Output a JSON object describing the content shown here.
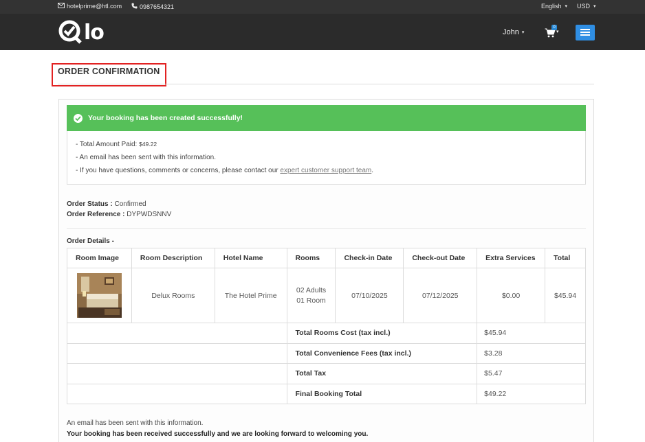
{
  "topbar": {
    "email": "hotelprime@htl.com",
    "phone": "0987654321",
    "language": "English",
    "currency": "USD"
  },
  "navbar": {
    "logo_text": "lo",
    "user_name": "John",
    "cart_count": "0"
  },
  "page": {
    "heading": "ORDER CONFIRMATION"
  },
  "alert": {
    "message": "Your booking has been created successfully!",
    "total_paid_label": "- Total Amount Paid:",
    "total_paid_value": "$49.22",
    "email_line": "- An email has been sent with this information.",
    "support_prefix": "- If you have questions, comments or concerns, please contact our",
    "support_link": "expert customer support team",
    "support_suffix": "."
  },
  "order": {
    "status_label": "Order Status :",
    "status_value": "Confirmed",
    "reference_label": "Order Reference :",
    "reference_value": "DYPWDSNNV",
    "details_label": "Order Details -"
  },
  "table": {
    "headers": [
      "Room Image",
      "Room Description",
      "Hotel Name",
      "Rooms",
      "Check-in Date",
      "Check-out Date",
      "Extra Services",
      "Total"
    ],
    "row": {
      "description": "Delux Rooms",
      "hotel": "The Hotel Prime",
      "adults": "02 Adults",
      "rooms": "01 Room",
      "checkin": "07/10/2025",
      "checkout": "07/12/2025",
      "extra": "$0.00",
      "total": "$45.94"
    },
    "summary": [
      {
        "label": "Total Rooms Cost (tax incl.)",
        "value": "$45.94"
      },
      {
        "label": "Total Convenience Fees (tax incl.)",
        "value": "$3.28"
      },
      {
        "label": "Total Tax",
        "value": "$5.47"
      },
      {
        "label": "Final Booking Total",
        "value": "$49.22"
      }
    ]
  },
  "footer": {
    "email_note": "An email has been sent with this information.",
    "welcome": "Your booking has been received successfully and we are looking forward to welcoming you."
  },
  "colors": {
    "success": "#56c059",
    "navbar": "#2b2b2b",
    "menu_button": "#2f8ee3",
    "highlight_box": "#e22222"
  }
}
